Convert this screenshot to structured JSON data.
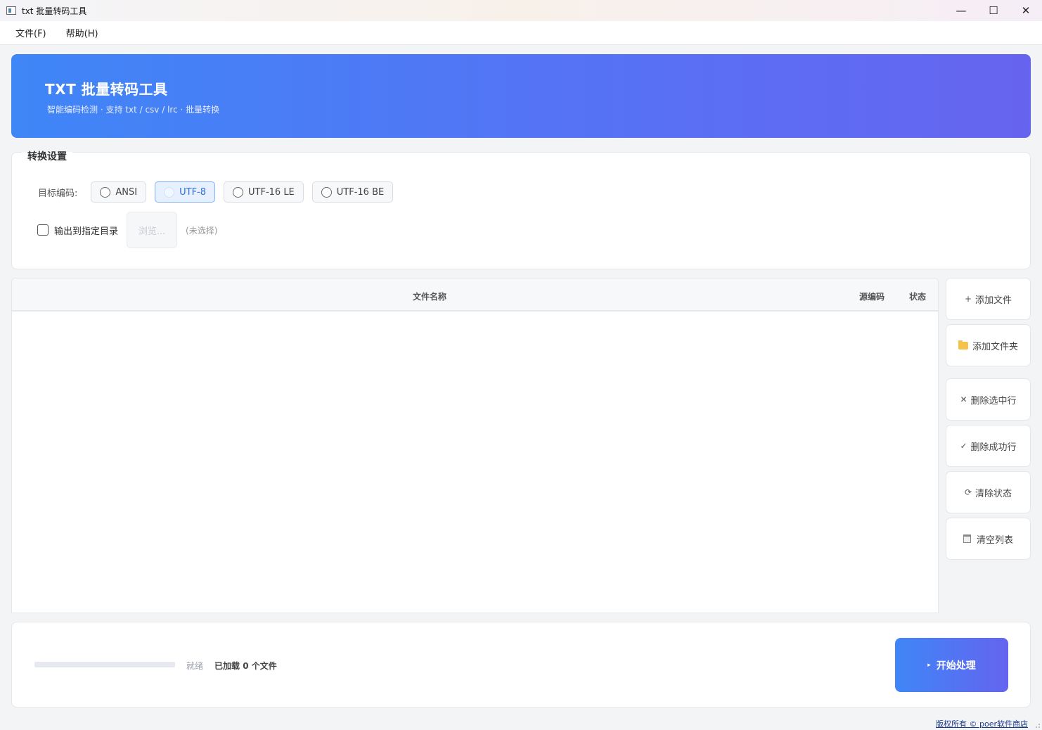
{
  "window": {
    "title": "txt 批量转码工具",
    "minimize": "—",
    "maximize": "☐",
    "close": "✕"
  },
  "menu": {
    "file": "文件(F)",
    "help": "帮助(H)"
  },
  "banner": {
    "title": "TXT 批量转码工具",
    "subtitle": "智能编码检测 · 支持 txt / csv / lrc · 批量转换",
    "gradient_start": "#3f86f7",
    "gradient_end": "#6664ef"
  },
  "settings": {
    "legend": "转换设置",
    "target_encoding_label": "目标编码:",
    "encodings": [
      {
        "label": "ANSI",
        "selected": false
      },
      {
        "label": "UTF-8",
        "selected": true
      },
      {
        "label": "UTF-16 LE",
        "selected": false
      },
      {
        "label": "UTF-16 BE",
        "selected": false
      }
    ],
    "output_dir_label": "输出到指定目录",
    "output_dir_checked": false,
    "browse_label": "浏览...",
    "output_path": "(未选择)"
  },
  "table": {
    "columns": [
      "文件名称",
      "源编码",
      "状态"
    ],
    "rows": []
  },
  "sidebar": {
    "add_file": {
      "icon": "plus-icon",
      "glyph": "+",
      "label": "添加文件"
    },
    "add_folder": {
      "icon": "folder-icon",
      "label": "添加文件夹"
    },
    "delete_selected": {
      "icon": "x-icon",
      "glyph": "✕",
      "label": "删除选中行"
    },
    "delete_success": {
      "icon": "check-icon",
      "glyph": "✓",
      "label": "删除成功行"
    },
    "clear_status": {
      "icon": "refresh-icon",
      "glyph": "⟳",
      "label": "清除状态"
    },
    "clear_list": {
      "icon": "trash-icon",
      "label": "清空列表"
    }
  },
  "bottom": {
    "progress_percent": 0,
    "status": "就绪",
    "count_prefix": "已加载",
    "count": "0",
    "count_suffix": "个文件",
    "start_label": "开始处理",
    "start_glyph": "▸"
  },
  "footer": {
    "copyright": "版权所有 © poer软件商店"
  }
}
